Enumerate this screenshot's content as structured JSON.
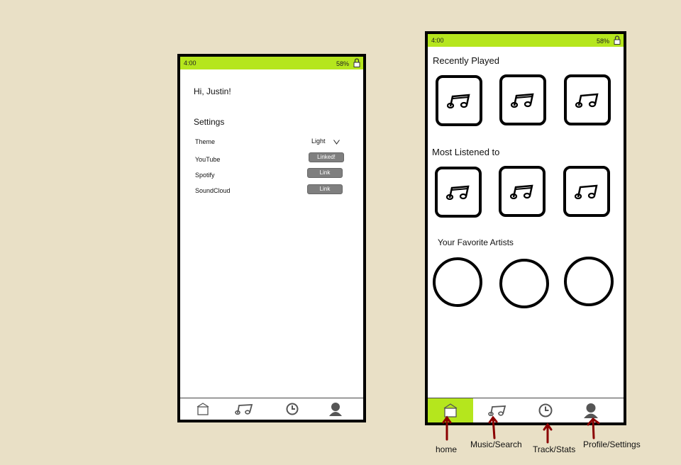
{
  "settings_screen": {
    "status": {
      "time": "4:00",
      "battery": "58%"
    },
    "greeting": "Hi, Justin!",
    "settings_title": "Settings",
    "rows": {
      "theme_label": "Theme",
      "theme_value": "Light",
      "youtube_label": "YouTube",
      "youtube_status": "Linked!",
      "spotify_label": "Spotify",
      "spotify_action": "Link",
      "soundcloud_label": "SoundCloud",
      "soundcloud_action": "Link"
    }
  },
  "home_screen": {
    "status": {
      "time": "4:00",
      "battery": "58%"
    },
    "recently_played_title": "Recently Played",
    "most_listened_title": "Most Listened to",
    "favorite_artists_title": "Your Favorite Artists"
  },
  "annotations": {
    "home": "home",
    "music": "Music/Search",
    "track": "Track/Stats",
    "profile": "Profile/Settings"
  },
  "colors": {
    "status_bar": "#b5e61d",
    "nav_active": "#b5e61d",
    "arrow": "#8b0000"
  },
  "icons": [
    "home-icon",
    "music-note-icon",
    "clock-icon",
    "user-icon",
    "lock-icon"
  ]
}
